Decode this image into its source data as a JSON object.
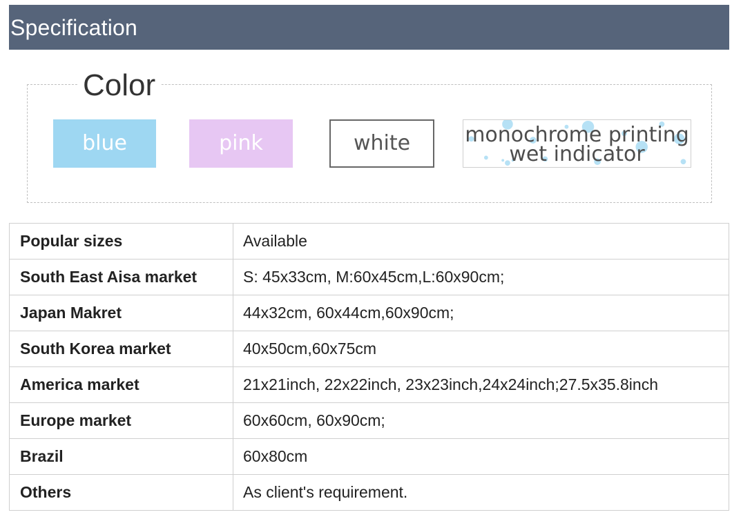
{
  "header": {
    "title": "Specification",
    "background": "#56647a"
  },
  "color_section": {
    "legend": "Color",
    "swatches": [
      {
        "label": "blue",
        "color": "#9ed7f2"
      },
      {
        "label": "pink",
        "color": "#e7c7f3"
      },
      {
        "label": "white",
        "color": "#ffffff"
      },
      {
        "label_line1": "monochrome printing",
        "label_line2": "wet indicator",
        "color": "#ffffff",
        "pattern": "blue-dots"
      }
    ]
  },
  "spec_table": {
    "rows": [
      {
        "label": "Popular sizes",
        "value": "Available"
      },
      {
        "label": "South East Aisa market",
        "value": "S: 45x33cm, M:60x45cm,L:60x90cm;"
      },
      {
        "label": "Japan Makret",
        "value": "44x32cm, 60x44cm,60x90cm;"
      },
      {
        "label": "South Korea market",
        "value": "40x50cm,60x75cm"
      },
      {
        "label": "America market",
        "value": "21x21inch, 22x22inch, 23x23inch,24x24inch;27.5x35.8inch"
      },
      {
        "label": "Europe market",
        "value": "60x60cm, 60x90cm;"
      },
      {
        "label": "Brazil",
        "value": "60x80cm"
      },
      {
        "label": "Others",
        "value": "As client's requirement."
      }
    ]
  }
}
